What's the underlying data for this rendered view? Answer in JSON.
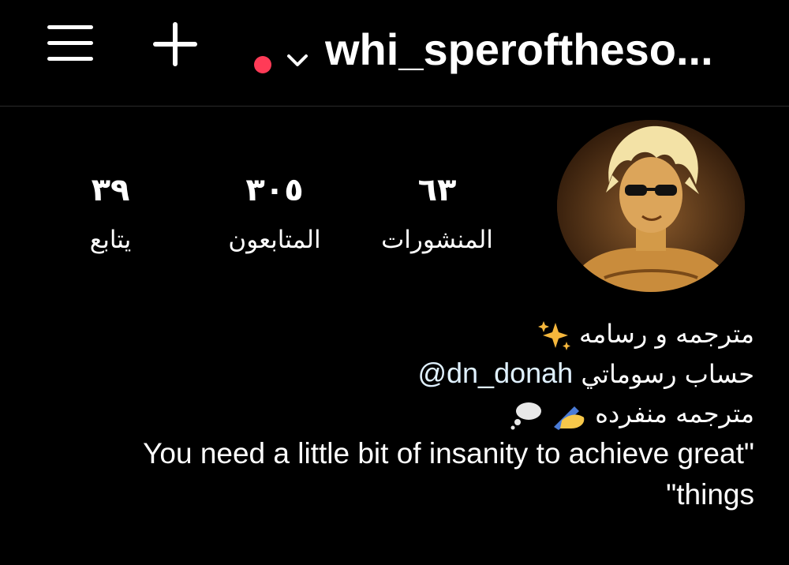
{
  "header": {
    "username": "whi_speroftheso...",
    "menu_icon": "hamburger-menu-icon",
    "create_icon": "plus-icon",
    "switcher_icon": "chevron-down-icon",
    "notification_color": "#ff3b57"
  },
  "profile": {
    "stats": {
      "posts": {
        "count": "٦٣",
        "label": "المنشورات"
      },
      "followers": {
        "count": "٣٠٥",
        "label": "المتابعون"
      },
      "following": {
        "count": "٣٩",
        "label": "يتابع"
      }
    },
    "bio": {
      "line1": "مترجمه و رسامه",
      "line2_text": "حساب رسوماتي",
      "line2_mention": "@dn_donah",
      "line3": "مترجمه منفرده",
      "quote_line1": "You need a little bit of insanity to achieve great\"",
      "quote_line2": "\"things",
      "mention_color": "#e0f1ff"
    }
  }
}
